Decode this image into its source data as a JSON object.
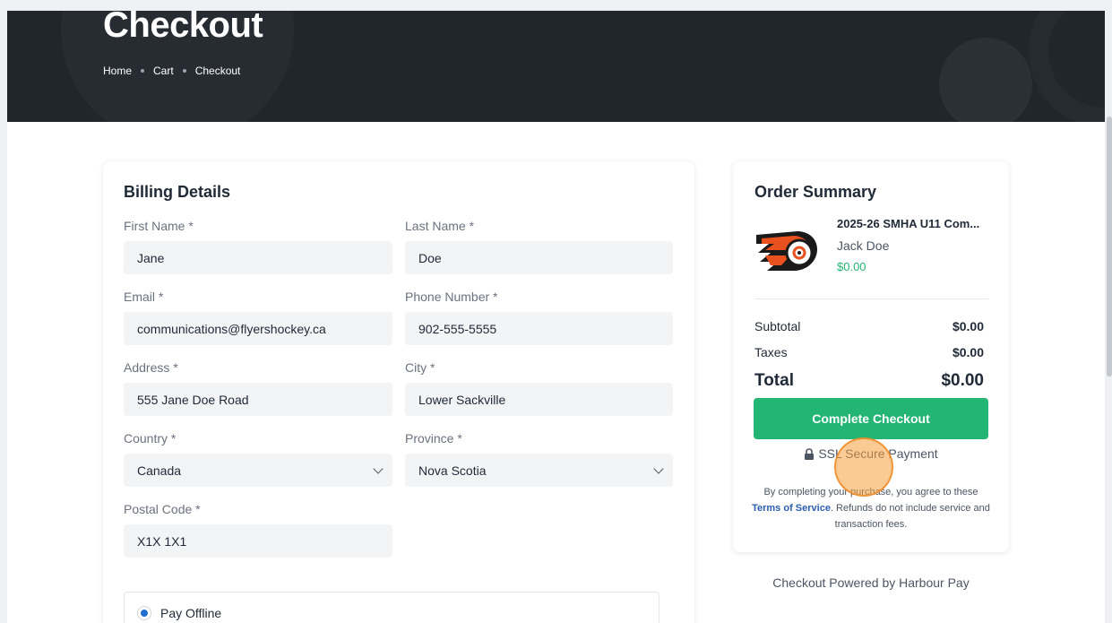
{
  "header": {
    "title": "Checkout",
    "breadcrumb": [
      "Home",
      "Cart",
      "Checkout"
    ]
  },
  "billing": {
    "title": "Billing Details",
    "first_name": {
      "label": "First Name *",
      "value": "Jane"
    },
    "last_name": {
      "label": "Last Name *",
      "value": "Doe"
    },
    "email": {
      "label": "Email *",
      "value": "communications@flyershockey.ca"
    },
    "phone": {
      "label": "Phone Number *",
      "value": "902-555-5555"
    },
    "address": {
      "label": "Address *",
      "value": "555 Jane Doe Road"
    },
    "city": {
      "label": "City *",
      "value": "Lower Sackville"
    },
    "country": {
      "label": "Country *",
      "value": "Canada"
    },
    "province": {
      "label": "Province *",
      "value": "Nova Scotia"
    },
    "postal": {
      "label": "Postal Code *",
      "value": "X1X 1X1"
    },
    "payment_option": "Pay Offline"
  },
  "summary": {
    "title": "Order Summary",
    "item": {
      "name": "2025-26 SMHA U11 Com...",
      "player": "Jack Doe",
      "price": "$0.00",
      "logo_icon": "flyers-sackville-logo"
    },
    "subtotal_label": "Subtotal",
    "subtotal_value": "$0.00",
    "taxes_label": "Taxes",
    "taxes_value": "$0.00",
    "total_label": "Total",
    "total_value": "$0.00",
    "checkout_button": "Complete Checkout",
    "ssl_text": "SSL Secure Payment",
    "legal_before": "By completing your purchase, you agree to these ",
    "legal_link": "Terms of Service",
    "legal_after": ". Refunds do not include service and transaction fees."
  },
  "footer": {
    "powered_by": "Checkout Powered by Harbour Pay"
  },
  "colors": {
    "hero_bg": "#21262d",
    "accent_green": "#22b573",
    "link_blue": "#2a5db0",
    "radio_blue": "#1f6fd1"
  }
}
